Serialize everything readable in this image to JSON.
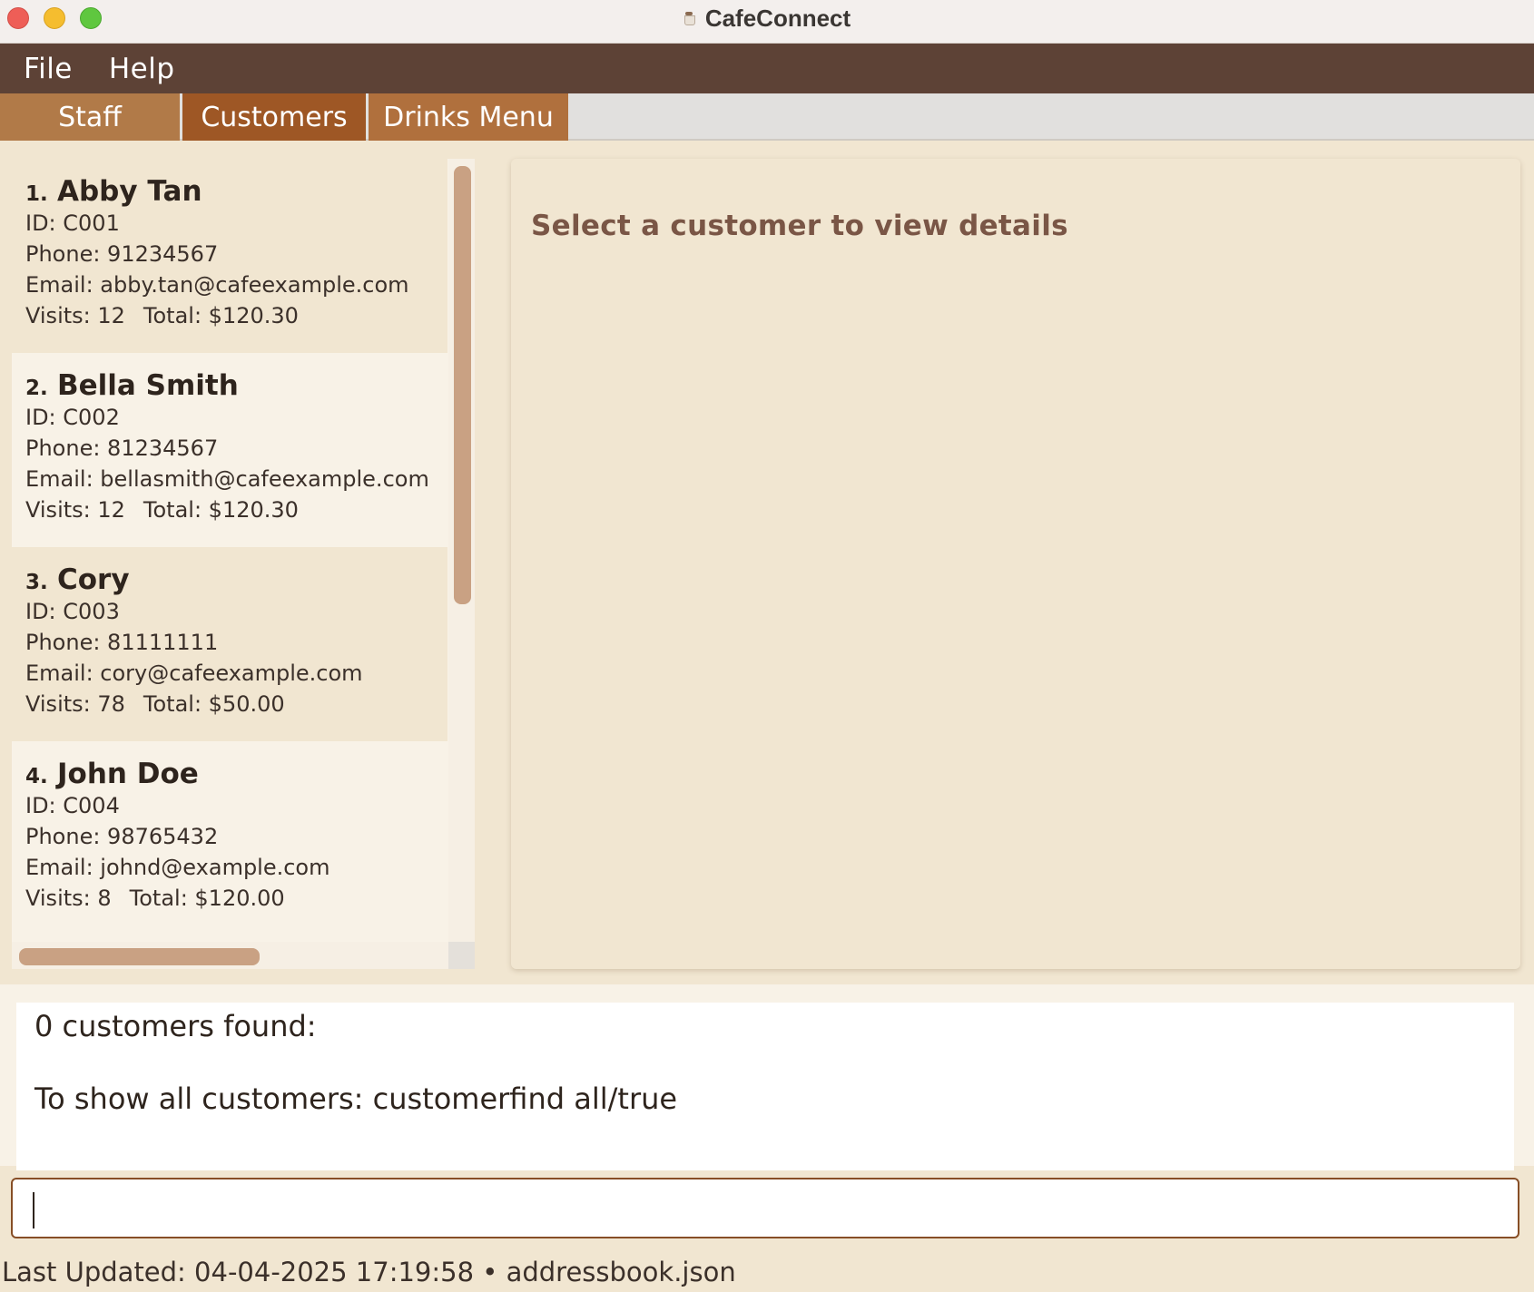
{
  "window": {
    "title": "CafeConnect"
  },
  "menu": [
    {
      "label": "File"
    },
    {
      "label": "Help"
    }
  ],
  "tabs": [
    {
      "label": "Staff"
    },
    {
      "label": "Customers",
      "active": true
    },
    {
      "label": "Drinks Menu"
    }
  ],
  "customers": [
    {
      "index": "1.",
      "name": "Abby Tan",
      "id": "ID: C001",
      "phone": "Phone: 91234567",
      "email": "Email: abby.tan@cafeexample.com",
      "visits": "Visits: 12",
      "total": "Total: $120.30"
    },
    {
      "index": "2.",
      "name": "Bella Smith",
      "id": "ID: C002",
      "phone": "Phone: 81234567",
      "email": "Email: bellasmith@cafeexample.com",
      "visits": "Visits: 12",
      "total": "Total: $120.30"
    },
    {
      "index": "3.",
      "name": "Cory",
      "id": "ID: C003",
      "phone": "Phone: 81111111",
      "email": "Email: cory@cafeexample.com",
      "visits": "Visits: 78",
      "total": "Total: $50.00"
    },
    {
      "index": "4.",
      "name": "John Doe",
      "id": "ID: C004",
      "phone": "Phone: 98765432",
      "email": "Email: johnd@example.com",
      "visits": "Visits: 8",
      "total": "Total: $120.00"
    }
  ],
  "details": {
    "placeholder": "Select a customer to view details"
  },
  "result": {
    "line1": "0 customers found:",
    "line2": "To show all customers: customerfind all/true"
  },
  "command": {
    "value": "",
    "placeholder": ""
  },
  "status": {
    "text": "Last Updated: 04-04-2025 17:19:58 • addressbook.json"
  },
  "colors": {
    "menubar": "#5d4236",
    "tab_active": "#9e5725",
    "tab_inactive": "#b17a48",
    "panel_bg": "#f1e6d1",
    "scroll_thumb": "#c9a183",
    "input_border": "#874e26"
  }
}
